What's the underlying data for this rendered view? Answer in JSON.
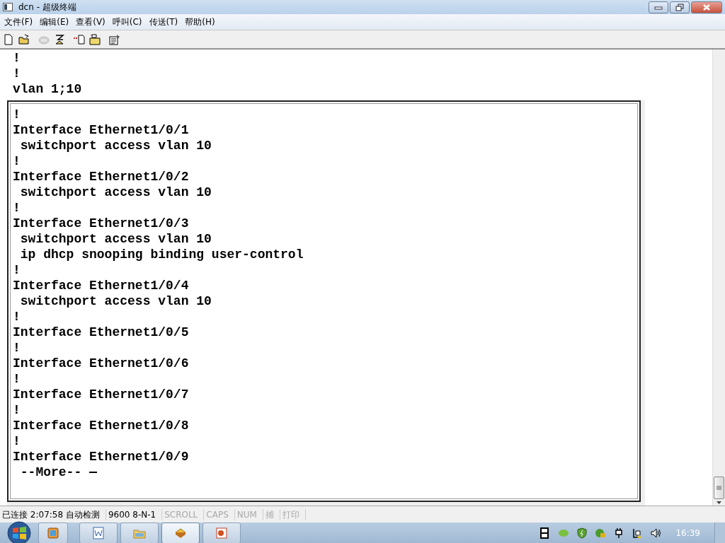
{
  "window": {
    "title": "dcn - 超级终端"
  },
  "menu": [
    "文件(F)",
    "编辑(E)",
    "查看(V)",
    "呼叫(C)",
    "传送(T)",
    "帮助(H)"
  ],
  "toolbar": [
    {
      "kind": "new",
      "disabled": false
    },
    {
      "kind": "open",
      "disabled": false
    },
    {
      "kind": "call",
      "disabled": true
    },
    {
      "kind": "hangup",
      "disabled": false
    },
    {
      "kind": "send",
      "disabled": false
    },
    {
      "kind": "receive",
      "disabled": false
    },
    {
      "kind": "properties",
      "disabled": false
    }
  ],
  "terminal": {
    "background_lines": [
      "!",
      "!",
      "vlan 1;10"
    ],
    "panel_lines": [
      "!",
      "Interface Ethernet1/0/1",
      " switchport access vlan 10",
      "!",
      "Interface Ethernet1/0/2",
      " switchport access vlan 10",
      "!",
      "Interface Ethernet1/0/3",
      " switchport access vlan 10",
      " ip dhcp snooping binding user-control",
      "!",
      "Interface Ethernet1/0/4",
      " switchport access vlan 10",
      "!",
      "Interface Ethernet1/0/5",
      "!",
      "Interface Ethernet1/0/6",
      "!",
      "Interface Ethernet1/0/7",
      "!",
      "Interface Ethernet1/0/8",
      "!",
      "Interface Ethernet1/0/9"
    ],
    "prompt": " --More-- "
  },
  "status_bar": [
    {
      "text": "已连接 2:07:58 自动检测",
      "disabled": false
    },
    {
      "text": "9600 8-N-1",
      "disabled": false
    },
    {
      "text": "SCROLL",
      "disabled": true
    },
    {
      "text": "CAPS",
      "disabled": true
    },
    {
      "text": "NUM",
      "disabled": true
    },
    {
      "text": "捕",
      "disabled": true
    },
    {
      "text": "打印",
      "disabled": true
    }
  ],
  "taskbar": {
    "apps": [
      {
        "kind": "window",
        "selected": false
      },
      {
        "kind": "word",
        "selected": false
      },
      {
        "kind": "folder",
        "selected": false
      },
      {
        "kind": "terminal",
        "selected": true
      },
      {
        "kind": "slides",
        "selected": false
      }
    ],
    "tray": [
      {
        "kind": "film"
      },
      {
        "kind": "green"
      },
      {
        "kind": "shield"
      },
      {
        "kind": "network-lock"
      },
      {
        "kind": "plug"
      },
      {
        "kind": "wifi-warning"
      },
      {
        "kind": "volume"
      }
    ],
    "clock": "16:39"
  }
}
